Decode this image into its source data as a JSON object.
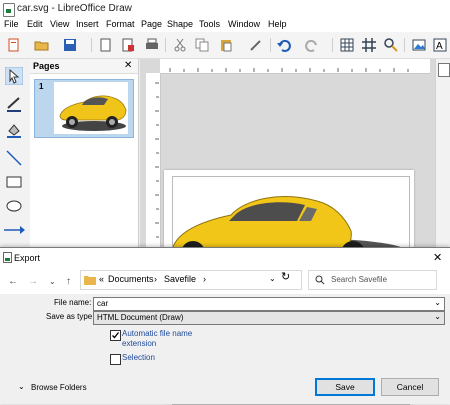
{
  "window": {
    "title": "car.svg - LibreOffice Draw"
  },
  "menubar": {
    "items": [
      "File",
      "Edit",
      "View",
      "Insert",
      "Format",
      "Page",
      "Shape",
      "Tools",
      "Window",
      "Help"
    ]
  },
  "pages_pane": {
    "title": "Pages",
    "page_number": "1"
  },
  "dialog": {
    "title": "Export",
    "breadcrumb": {
      "prefix": "«",
      "segment1": "Documents",
      "sep": "›",
      "segment2": "Savefile",
      "sep2": "›"
    },
    "search_placeholder": "Search Savefile",
    "file_name_label": "File name:",
    "file_name_value": "car",
    "save_type_label": "Save as type:",
    "save_type_value": "HTML Document (Draw)",
    "auto_ext_label_1": "Automatic file name",
    "auto_ext_label_2": "extension",
    "auto_ext_checked": true,
    "selection_label": "Selection",
    "selection_checked": false,
    "browse_folders_label": "Browse Folders",
    "save_label": "Save",
    "cancel_label": "Cancel"
  }
}
